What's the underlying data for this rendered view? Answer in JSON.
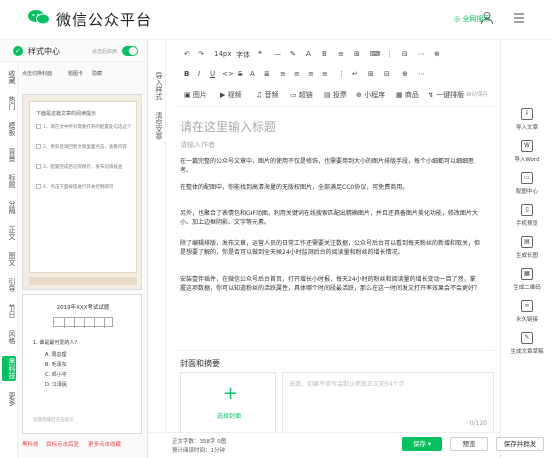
{
  "header": {
    "title": "微信公众平台",
    "search_label": "◎ 全网搜索"
  },
  "left_panel": {
    "title": "样式中心",
    "switch_label": "点击后启用",
    "vertical_tabs": [
      "收藏",
      "热门",
      "模板",
      "背景",
      "标题",
      "分隔",
      "正文",
      "图文",
      "引导",
      "节日",
      "风格",
      "黑科技",
      "更多"
    ],
    "active_tab": "黑科技",
    "sub_tabs": [
      "点击切换封面",
      "题图卡",
      "隐藏"
    ],
    "template1": {
      "heading": "下面是这篇文章的阅读提示",
      "items": [
        "1、请在文中所有需要打开的配置处勾选这个",
        "2、更新后请回到文章里面点击，查看内容",
        "3、配置完成后记得保存，发布前请核查",
        "4、点击下面按钮进行开关控制即可"
      ]
    },
    "template2": {
      "title": "2019年XXX考试试题",
      "question": "1. 谁是最可爱的人?",
      "options": [
        "A. 周总理",
        "B. 毛泽东",
        "C. 邓小平",
        "D. 江泽民"
      ],
      "footer": "答题完成后点击提交"
    },
    "footer_links": [
      "黑科技",
      "目标点击后显",
      "更多点击收藏"
    ]
  },
  "middle_tabs": [
    "导入样式",
    "清空文章"
  ],
  "toolbar": {
    "row1": [
      "↶",
      "↷",
      "14px",
      "字体",
      "❝",
      "—",
      "✎",
      "A",
      "B",
      "≡",
      "⊞",
      "⌨",
      "⋮",
      "⊟",
      "⋯",
      "⊕"
    ],
    "row2": [
      "B",
      "I",
      "U",
      "<>",
      "S",
      "A",
      "≣",
      "≡",
      "≡",
      "≡",
      "≡",
      "⋮",
      "↵",
      "⊞",
      "⊟",
      "⊕",
      "⋯"
    ],
    "row3": [
      "▣ 图片",
      "▶ 视频",
      "♫ 音频",
      "▭ 超链",
      "▤ 投票",
      "⊕ 小程序",
      "▦ 商品",
      "↯ 一键排版",
      "自动保存"
    ]
  },
  "editor": {
    "title_placeholder": "请在这里输入标题",
    "author_placeholder": "请输入作者",
    "paragraphs": [
      "在一篇完整的公众号文章中，图片的使用不仅是修饰，也需要用到大小的图片排版手段，每个小细都可以细细思考。",
      "在整体的配图中，你能找到高清海量的无版权图片，全部满足CC0协议，可免费商用。",
      "另外，也聚合了表情包和GIF动图，利用关键词在线搜索匹配出精确图片，并且还具备图片美化功能，修改图片大小、加上边框阴影、文字等元素。",
      "除了编辑排版，发布文章，运营人员的日常工作还需要关注数据，公众号后台可以看到每天粉丝的新增和取关，但是想要了解的，你是否可以做到全天候24小时监测后台的阅读量和粉丝的增长情况。",
      "安装壹伴插件，在微信公众号后台首页，打开增长小时报，每天24小时的粉丝和阅读量的增长变动一目了然，掌握这项数据，你可以知道粉丝的活跃属性，具体哪个时间段最活跃，那么在这一时间发文打开率效果会不会更好？"
    ],
    "cover_section_title": "封面和摘要",
    "cover_button": "选择封面",
    "summary_placeholder": "选填，如果不填写会默认抓取正文前54个字",
    "summary_count": "0/120"
  },
  "right_panel": [
    {
      "icon": "import-icon",
      "glyph": "⇩",
      "label": "导入文章"
    },
    {
      "icon": "word-icon",
      "glyph": "W",
      "label": "导入Word"
    },
    {
      "icon": "image-icon",
      "glyph": "▭",
      "label": "配图中心"
    },
    {
      "icon": "mobile-icon",
      "glyph": "▯",
      "label": "手机预览"
    },
    {
      "icon": "longimage-icon",
      "glyph": "▤",
      "label": "生成长图"
    },
    {
      "icon": "qrcode-icon",
      "glyph": "▦",
      "label": "生成二维码"
    },
    {
      "icon": "link-icon",
      "glyph": "∞",
      "label": "永久链接"
    },
    {
      "icon": "doc-icon",
      "glyph": "✎",
      "label": "生成文章草稿"
    }
  ],
  "bottom_bar": {
    "word_count": "正文字数：358字 0图",
    "read_time": "预计阅读时间：1分钟",
    "save": "保存",
    "preview": "预览",
    "send": "保存并群发"
  },
  "colors": {
    "accent": "#07c160",
    "highlight_blue": "#2f6fd6",
    "footer_red": "#e54545"
  }
}
